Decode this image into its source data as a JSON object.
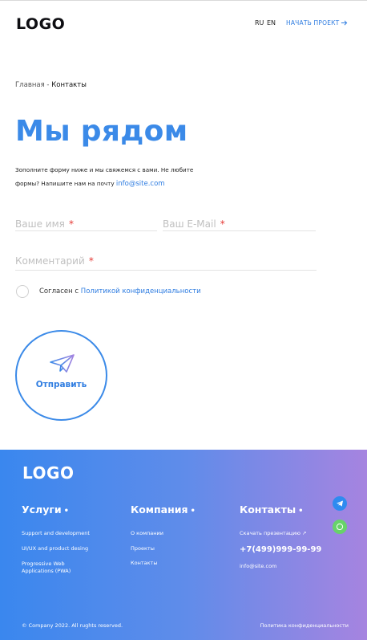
{
  "header": {
    "logo": "LOGO",
    "lang_ru": "RU",
    "lang_en": "EN",
    "cta_label": "НАЧАТЬ ПРОЕКТ"
  },
  "breadcrumb": {
    "home": "Главная",
    "separator": "-",
    "current": "Контакты"
  },
  "page": {
    "title": "Мы рядом",
    "description": "Зополните форму ниже и мы свяжемся с вами. Не любите формы? Напишите нам на почту",
    "email": "info@site.com"
  },
  "form": {
    "name_placeholder": "Ваше имя",
    "email_placeholder": "Ваш E-Mail",
    "comment_placeholder": "Комментарий",
    "required_mark": "*",
    "agree_text": "Согласен с",
    "agree_link": "Политикой конфиденциальности",
    "agree_checked": false,
    "submit_label": "Отправить"
  },
  "footer": {
    "logo": "LOGO",
    "services": {
      "title": "Услуги",
      "dot": "•",
      "items": [
        "Support and development",
        "UI/UX and product desing",
        "Progressive Web Applications (PWA)"
      ]
    },
    "company": {
      "title": "Компания",
      "dot": "•",
      "items": [
        "О компании",
        "Проекты",
        "Контакты"
      ]
    },
    "contacts": {
      "title": "Контакты",
      "dot": "•",
      "download": "Скачать презентацию ↗",
      "phone": "+7(499)999-99-99",
      "email": "info@site.com"
    },
    "copyright": "© Company 2022. All rughts reserved.",
    "privacy": "Политика конфиденциальности"
  },
  "colors": {
    "accent": "#3b8ae8",
    "link": "#2f7de1",
    "required": "#e53935",
    "footer_gradient_start": "#3a87ee",
    "footer_gradient_end": "#a684e0",
    "telegram": "#2e8bf0",
    "whatsapp": "#67d36a"
  },
  "icons": {
    "cta": "arrow-right-icon",
    "submit": "paper-plane-icon",
    "social_1": "telegram-icon",
    "social_2": "whatsapp-icon"
  }
}
